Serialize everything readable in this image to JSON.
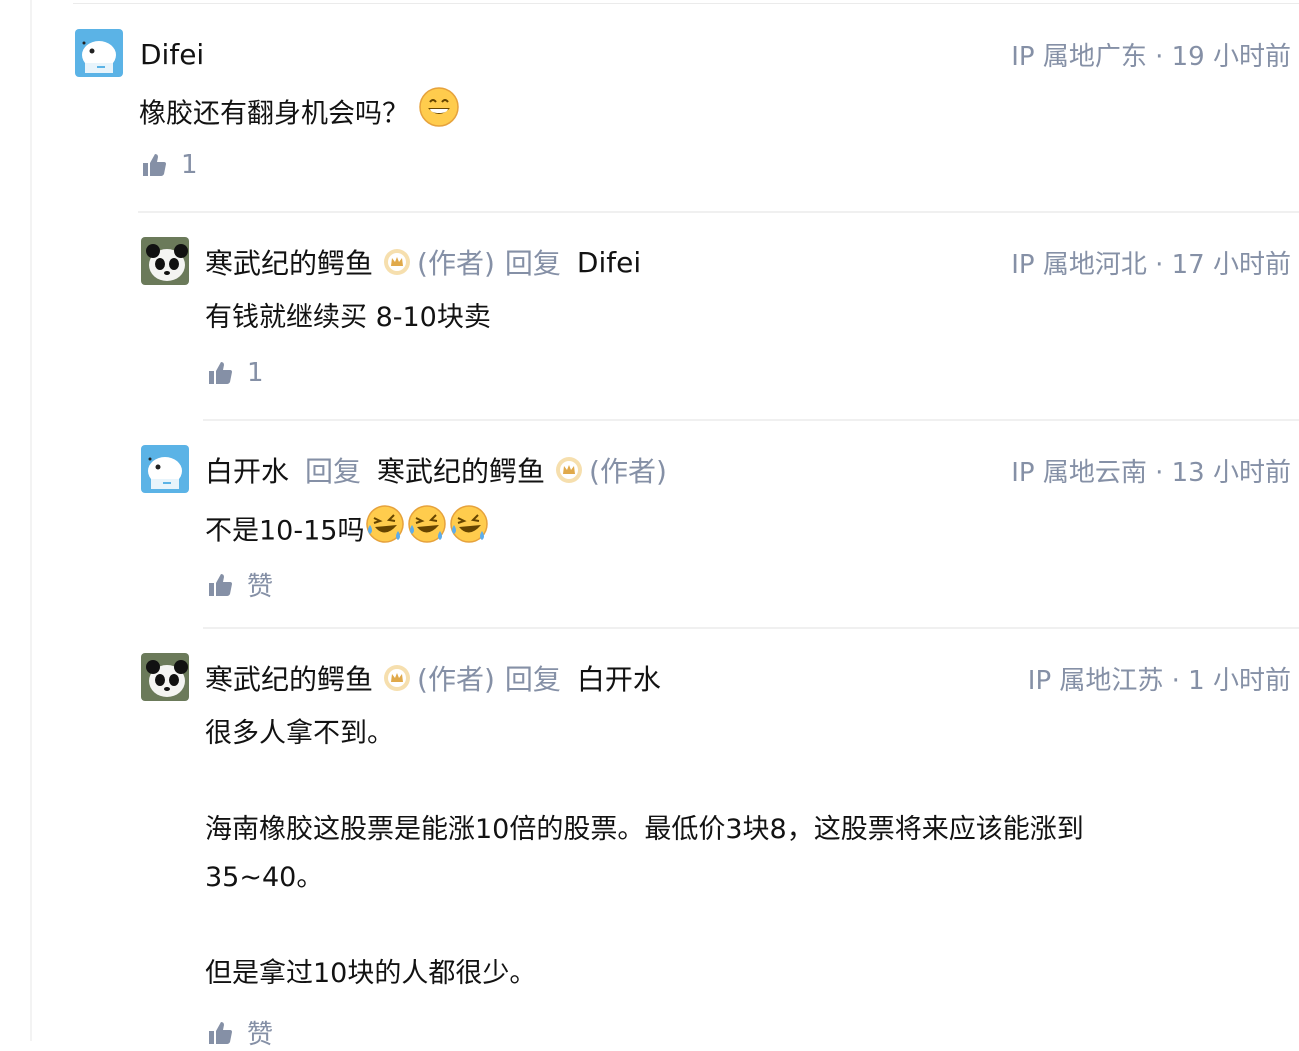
{
  "comments": [
    {
      "author": "Difei",
      "meta": "IP 属地广东 · 19 小时前",
      "text": "橡胶还有翻身机会吗？",
      "likes": "1"
    },
    {
      "author": "寒武纪的鳄鱼",
      "author_tag": "(作者)",
      "reply_word": "回复",
      "reply_to": "Difei",
      "meta": "IP 属地河北 · 17 小时前",
      "text": "有钱就继续买 8-10块卖",
      "likes": "1"
    },
    {
      "author": "白开水",
      "reply_word": "回复",
      "reply_to": "寒武纪的鳄鱼",
      "reply_to_tag": "(作者)",
      "meta": "IP 属地云南 · 13 小时前",
      "text": "不是10-15吗",
      "likes": "赞"
    },
    {
      "author": "寒武纪的鳄鱼",
      "author_tag": "(作者)",
      "reply_word": "回复",
      "reply_to": "白开水",
      "meta": "IP 属地江苏 · 1 小时前",
      "paragraphs": [
        "很多人拿不到。",
        "海南橡胶这股票是能涨10倍的股票。最低价3块8，这股票将来应该能涨到",
        "35~40。",
        "但是拿过10块的人都很少。"
      ],
      "likes": "赞"
    }
  ],
  "icons": {
    "like": "thumbs-up-icon",
    "badge": "crown-badge-icon",
    "grin": "grinning-emoji",
    "laugh_cry": "laughing-crying-emoji"
  },
  "colors": {
    "muted": "#8590a6",
    "text": "#121212",
    "badge": "#e0a94a"
  }
}
